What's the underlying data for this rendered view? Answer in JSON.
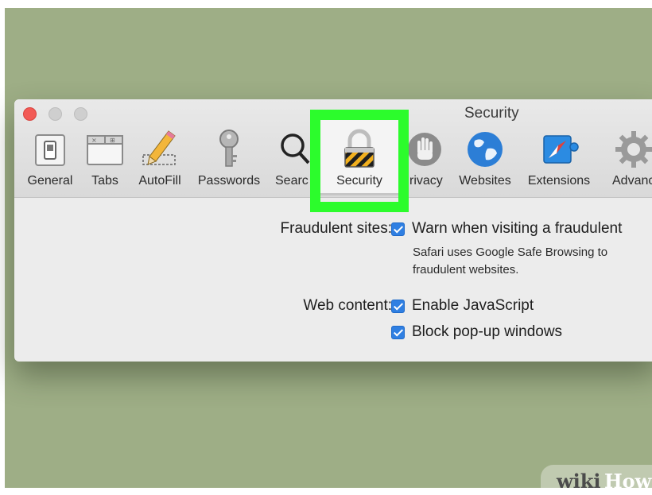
{
  "window": {
    "title": "Security"
  },
  "toolbar": {
    "items": [
      {
        "label": "General",
        "icon": "general-switch-icon"
      },
      {
        "label": "Tabs",
        "icon": "tabs-icon"
      },
      {
        "label": "AutoFill",
        "icon": "pencil-icon"
      },
      {
        "label": "Passwords",
        "icon": "key-icon"
      },
      {
        "label": "Searc",
        "icon": "magnifier-icon"
      },
      {
        "label": "Security",
        "icon": "padlock-icon",
        "selected": true
      },
      {
        "label": "rivacy",
        "icon": "hand-icon"
      },
      {
        "label": "Websites",
        "icon": "globe-icon"
      },
      {
        "label": "Extensions",
        "icon": "compass-puzzle-icon"
      },
      {
        "label": "Advanc",
        "icon": "gear-icon"
      }
    ]
  },
  "security": {
    "fraudulent_label": "Fraudulent sites:",
    "fraudulent_option": "Warn when visiting a fraudulent",
    "fraudulent_desc_1": "Safari uses Google Safe Browsing to",
    "fraudulent_desc_2": "fraudulent websites.",
    "web_content_label": "Web content:",
    "enable_js": "Enable JavaScript",
    "block_popups": "Block pop-up windows",
    "fraudulent_checked": true,
    "enable_js_checked": true,
    "block_popups_checked": true
  },
  "colors": {
    "background": "#9eae86",
    "highlight": "#2cfc2c",
    "checkbox": "#2f7fe2",
    "close_button": "#f25a55"
  },
  "watermark": {
    "wiki": "wiki",
    "how": "How"
  }
}
